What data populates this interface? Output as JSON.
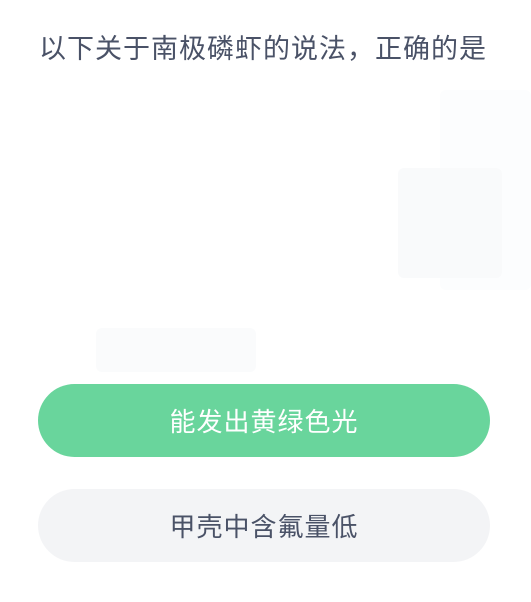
{
  "question": {
    "text": "以下关于南极磷虾的说法，正确的是"
  },
  "options": [
    {
      "label": "能发出黄绿色光",
      "color": "#69d59c"
    },
    {
      "label": "甲壳中含氟量低",
      "color": "#f3f4f6"
    }
  ],
  "colors": {
    "text": "#4a5267",
    "accent": "#69d59c",
    "option_bg": "#f3f4f6",
    "background": "#ffffff"
  }
}
